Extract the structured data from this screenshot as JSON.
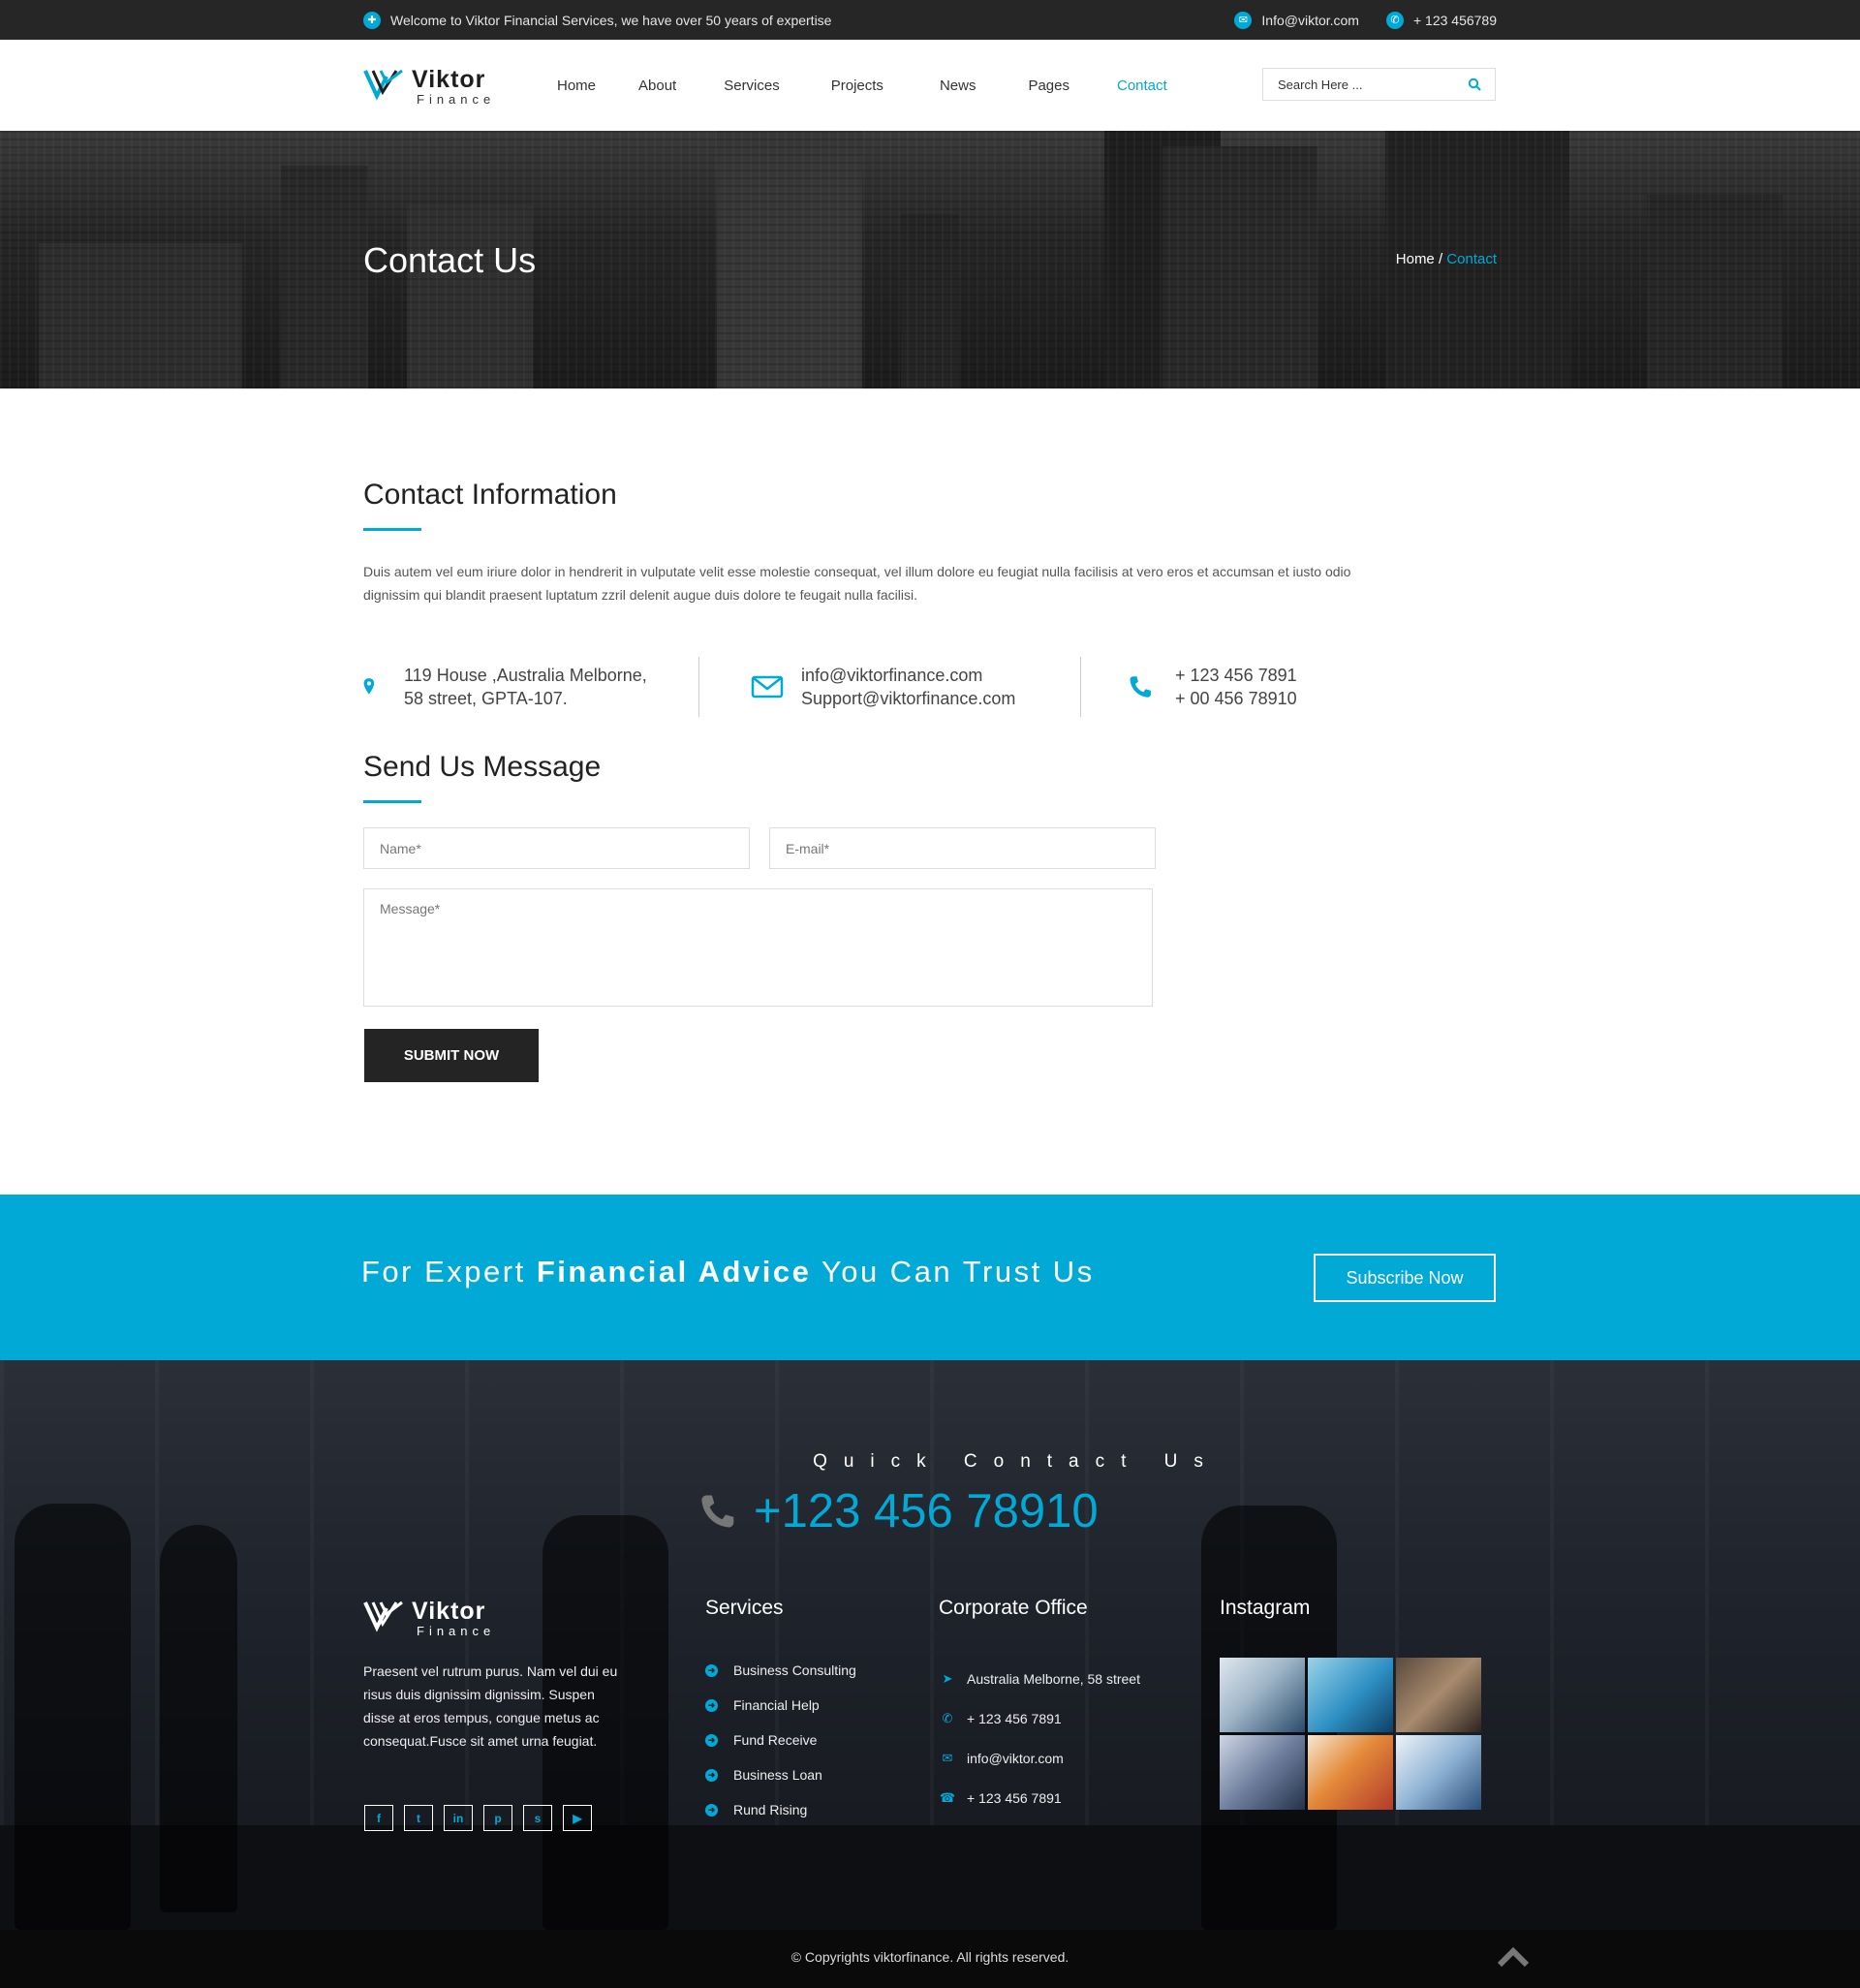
{
  "topbar": {
    "welcome": "Welcome to Viktor  Financial Services, we have over 50 years of expertise",
    "email": "Info@viktor.com",
    "phone": "+ 123 456789"
  },
  "brand": {
    "name": "Viktor",
    "tagline": "Finance"
  },
  "nav": {
    "items": [
      {
        "label": "Home"
      },
      {
        "label": "About"
      },
      {
        "label": "Services"
      },
      {
        "label": "Projects"
      },
      {
        "label": "News"
      },
      {
        "label": "Pages"
      },
      {
        "label": "Contact",
        "active": true
      }
    ],
    "search_placeholder": "Search Here ..."
  },
  "banner": {
    "title": "Contact Us",
    "breadcrumb_home": "Home",
    "breadcrumb_sep": " / ",
    "breadcrumb_current": "Contact"
  },
  "contact_info": {
    "title": "Contact Information",
    "text": "Duis autem vel eum iriure dolor in hendrerit in vulputate velit esse molestie consequat, vel illum dolore eu feugiat nulla facilisis at vero eros et accumsan et iusto odio dignissim qui blandit praesent luptatum zzril delenit augue duis dolore te feugait nulla facilisi.",
    "address_line1": "119 House ,Australia Melborne,",
    "address_line2": "58 street, GPTA-107.",
    "email_line1": "info@viktorfinance.com",
    "email_line2": "Support@viktorfinance.com",
    "phone_line1": "+ 123 456 7891",
    "phone_line2": "+ 00 456 78910"
  },
  "form": {
    "title": "Send Us Message",
    "name_placeholder": "Name*",
    "email_placeholder": "E-mail*",
    "message_placeholder": "Message*",
    "submit_label": "SUBMIT NOW"
  },
  "cta": {
    "text_pre": "For Expert ",
    "text_bold": "Financial Advice",
    "text_post": " You Can Trust Us",
    "button": "Subscribe Now"
  },
  "footer": {
    "quick_contact_label": "Quick Contact Us",
    "quick_contact_phone": "+123 456 78910",
    "about": "Praesent vel rutrum purus. Nam vel dui eu risus duis dignissim dignissim. Suspen disse at eros tempus, congue metus ac consequat.Fusce sit amet urna feugiat.",
    "social": [
      {
        "icon": "facebook-icon",
        "glyph": "f"
      },
      {
        "icon": "twitter-icon",
        "glyph": "t"
      },
      {
        "icon": "linkedin-icon",
        "glyph": "in"
      },
      {
        "icon": "pinterest-icon",
        "glyph": "p"
      },
      {
        "icon": "skype-icon",
        "glyph": "s"
      },
      {
        "icon": "youtube-icon",
        "glyph": "▶"
      }
    ],
    "services_title": "Services",
    "services": [
      "Business Consulting",
      "Financial Help",
      "Fund Receive",
      "Business Loan",
      "Rund Rising"
    ],
    "corporate_title": "Corporate Office",
    "corporate": [
      {
        "icon": "paper-plane-icon",
        "glyph": "➤",
        "text": "Australia Melborne, 58 street"
      },
      {
        "icon": "phone-icon",
        "glyph": "✆",
        "text": "+ 123 456 7891"
      },
      {
        "icon": "envelope-icon",
        "glyph": "✉",
        "text": "info@viktor.com"
      },
      {
        "icon": "fax-icon",
        "glyph": "☎",
        "text": "+ 123 456 7891"
      }
    ],
    "instagram_title": "Instagram",
    "copyright": "© Copyrights viktorfinance. All rights reserved."
  },
  "colors": {
    "accent": "#00a9d6",
    "dark": "#262626",
    "button": "#242424"
  }
}
